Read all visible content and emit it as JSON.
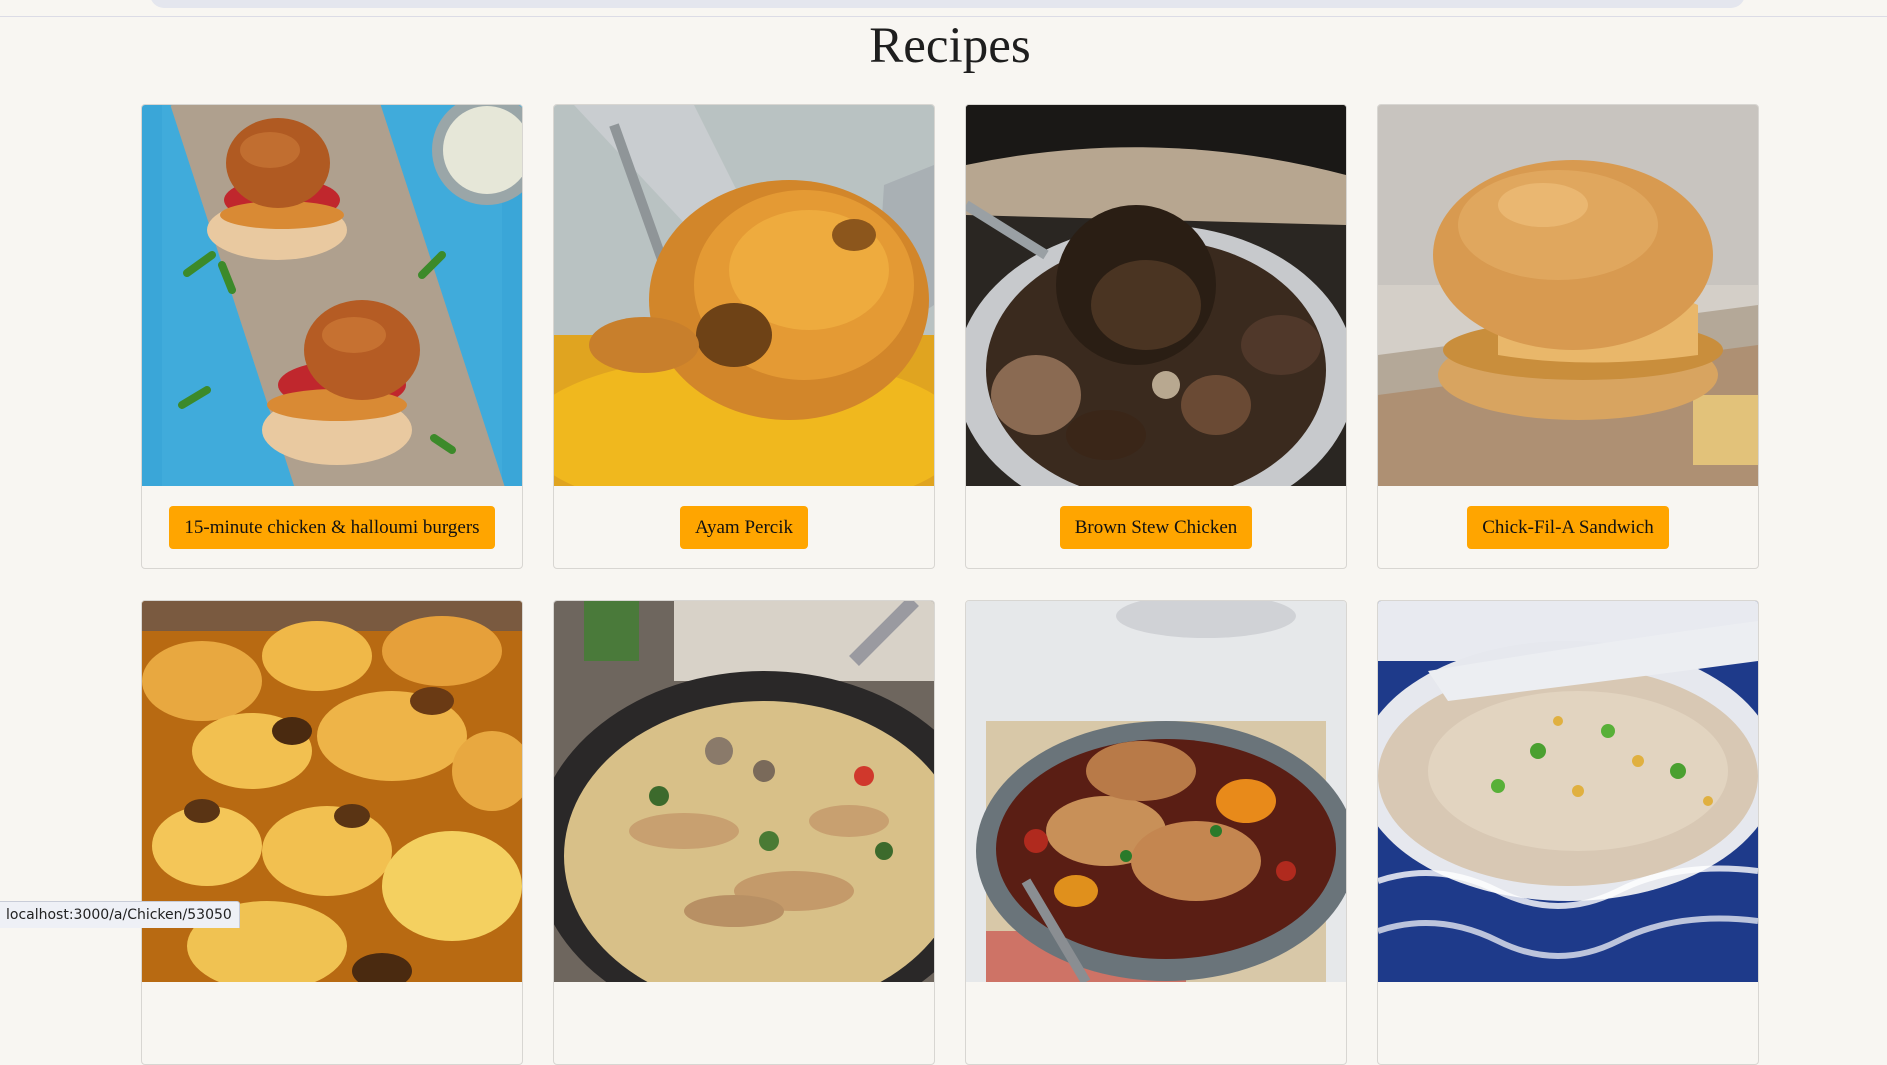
{
  "page": {
    "title": "Recipes"
  },
  "recipes": [
    {
      "label": "15-minute chicken & halloumi burgers",
      "image": "chicken-halloumi-burgers-photo"
    },
    {
      "label": "Ayam Percik",
      "image": "ayam-percik-photo"
    },
    {
      "label": "Brown Stew Chicken",
      "image": "brown-stew-chicken-photo"
    },
    {
      "label": "Chick-Fil-A Sandwich",
      "image": "chick-fil-a-sandwich-photo"
    },
    {
      "label": "",
      "image": "potato-bake-photo"
    },
    {
      "label": "",
      "image": "chicken-pasta-skillet-photo"
    },
    {
      "label": "",
      "image": "chicken-casserole-photo"
    },
    {
      "label": "",
      "image": "congee-bowl-photo"
    }
  ],
  "status_bar": {
    "url": "localhost:3000/a/Chicken/53050"
  },
  "colors": {
    "background": "#f8f6f2",
    "button": "#ffa500"
  }
}
